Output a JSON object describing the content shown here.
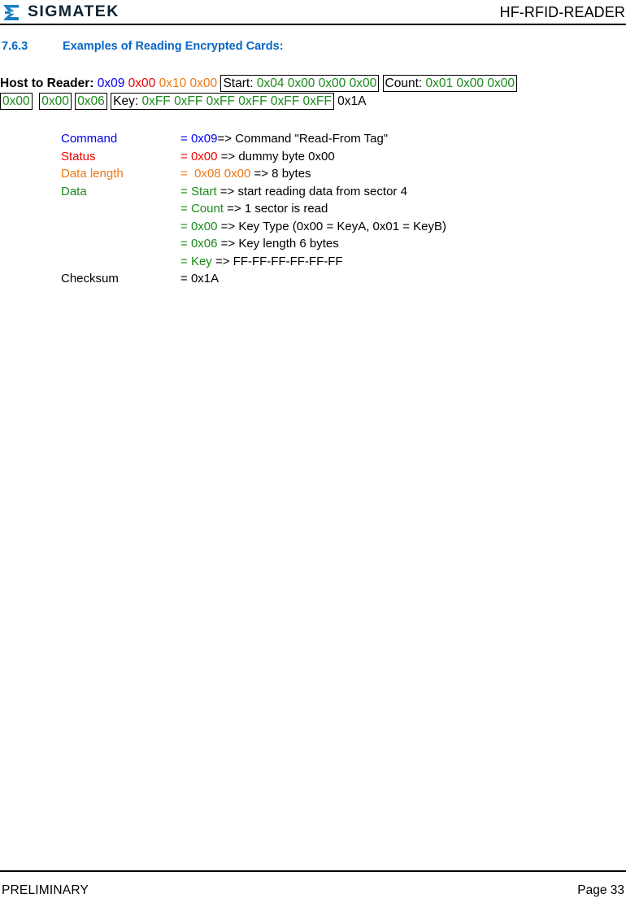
{
  "header": {
    "brand": "SIGMATEK",
    "logo_icon": "sigmatek-sigma-logo-icon",
    "logo_color": "#1a7fc1",
    "document_title": "HF-RFID-READER"
  },
  "section": {
    "number": "7.6.3",
    "title": "Examples of Reading Encrypted Cards:",
    "color": "#0a66c2"
  },
  "frame": {
    "label": "Host to Reader:",
    "line1": {
      "command": "0x09",
      "status": "0x00",
      "length_lo": "0x10",
      "length_hi": "0x00",
      "start_label": "Start:",
      "start_bytes": "0x04 0x00 0x00 0x00",
      "count_label": "Count:",
      "count_bytes": "0x01 0x00 0x00"
    },
    "line2": {
      "count_byte4": "0x00",
      "key_type": "0x00",
      "key_length": "0x06",
      "key_label": "Key:",
      "key_bytes": "0xFF 0xFF 0xFF 0xFF 0xFF 0xFF",
      "checksum": "0x1A"
    },
    "colors": {
      "command": "#0000ee",
      "status": "#ee0000",
      "data_length": "#ee7711",
      "data": "#1a8a1a",
      "checksum": "#000000"
    }
  },
  "details": [
    {
      "label": "Command",
      "label_color": "blue",
      "eq": "=",
      "value": "0x09",
      "value_color": "blue",
      "gap": "",
      "arrow": "=>",
      "description": " Command \"Read-From Tag\""
    },
    {
      "label": "Status",
      "label_color": "red",
      "eq": "=",
      "value": "0x00",
      "value_color": "red",
      "gap": " ",
      "arrow": "=>",
      "description": " dummy byte 0x00"
    },
    {
      "label": "Data length",
      "label_color": "orange",
      "eq": "=",
      "value": " 0x08 0x00",
      "value_color": "orange",
      "gap": " ",
      "arrow": "=>",
      "description": " 8 bytes"
    },
    {
      "label": "Data",
      "label_color": "green",
      "eq": "=",
      "value": "Start",
      "value_color": "green",
      "gap": " ",
      "arrow": "=>",
      "description": " start reading data from sector 4"
    },
    {
      "label": "",
      "label_color": "green",
      "eq": "=",
      "value": "Count",
      "value_color": "green",
      "gap": " ",
      "arrow": "=>",
      "description": " 1 sector is read"
    },
    {
      "label": "",
      "label_color": "green",
      "eq": "=",
      "value": "0x00",
      "value_color": "green",
      "gap": " ",
      "arrow": "=>",
      "description": " Key Type (0x00 = KeyA, 0x01 = KeyB)"
    },
    {
      "label": "",
      "label_color": "green",
      "eq": "=",
      "value": "0x06",
      "value_color": "green",
      "gap": " ",
      "arrow": "=>",
      "description": " Key length 6 bytes"
    },
    {
      "label": "",
      "label_color": "green",
      "eq": "=",
      "value": "Key",
      "value_color": "green",
      "gap": " ",
      "arrow": "=>",
      "description": " FF-FF-FF-FF-FF-FF"
    },
    {
      "label": "Checksum",
      "label_color": "black",
      "eq": "=",
      "value": "0x1A",
      "value_color": "black",
      "gap": "",
      "arrow": "",
      "description": ""
    }
  ],
  "footer": {
    "status": "PRELIMINARY",
    "page": "Page 33"
  }
}
